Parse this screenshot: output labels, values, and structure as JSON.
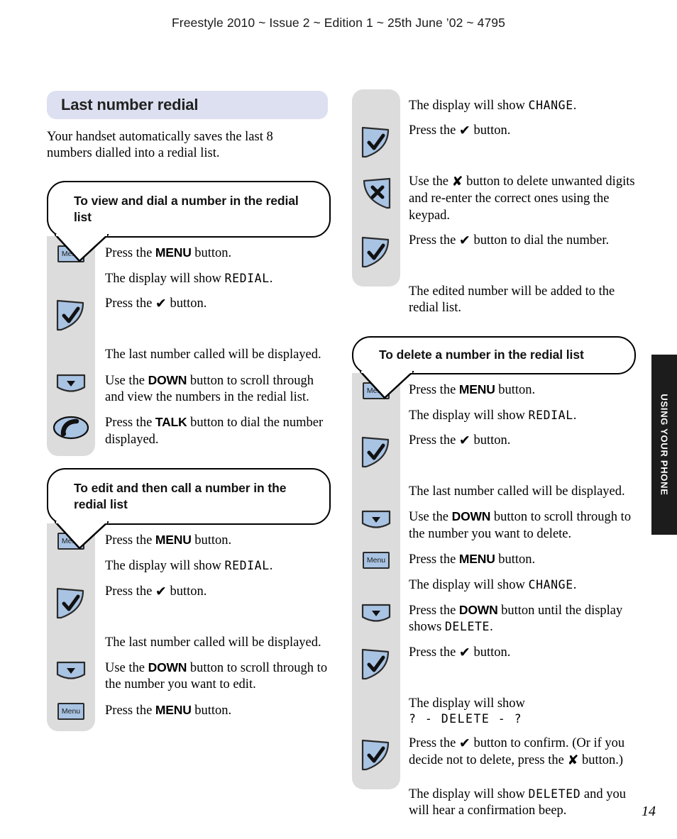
{
  "header": {
    "running_head": "Freestyle 2010 ~ Issue 2 ~ Edition 1 ~ 25th June ’02 ~ 4795"
  },
  "folio": {
    "page_number": "14"
  },
  "thumb_tab": {
    "label": "USING YOUR PHONE"
  },
  "colors": {
    "title_band": "#dde0f0",
    "icon_blue": "#a9c3e3",
    "rail_grey": "#dcdcdc",
    "tab_black": "#1c1c1c",
    "outline": "#2b2b2b"
  },
  "section": {
    "title": "Last number redial",
    "intro": "Your handset automatically saves the last 8 numbers dialled into a redial list."
  },
  "icons": {
    "menu_label": "Menu",
    "check": "check-button-icon",
    "cross": "cross-button-icon",
    "down": "down-button-icon",
    "talk": "talk-button-icon"
  },
  "procedures": [
    {
      "id": "view-and-dial",
      "heading": "To view and dial a number in the redial list",
      "column": "left",
      "steps": [
        {
          "icon": "menu",
          "parts": [
            {
              "t": "Press the "
            },
            {
              "t": "MENU",
              "s": "btn"
            },
            {
              "t": " button."
            }
          ]
        },
        {
          "icon": "none",
          "parts": [
            {
              "t": "The display will show "
            },
            {
              "t": "REDIAL",
              "s": "lcd"
            },
            {
              "t": "."
            }
          ]
        },
        {
          "icon": "check",
          "parts": [
            {
              "t": "Press the "
            },
            {
              "t": "✔",
              "s": "glyph"
            },
            {
              "t": " button."
            }
          ]
        },
        {
          "icon": "none",
          "parts": [
            {
              "t": "The last number called will be displayed."
            }
          ]
        },
        {
          "icon": "down",
          "parts": [
            {
              "t": "Use the "
            },
            {
              "t": "DOWN",
              "s": "btn"
            },
            {
              "t": " button to scroll through and view the numbers in the redial list."
            }
          ]
        },
        {
          "icon": "talk",
          "parts": [
            {
              "t": "Press the "
            },
            {
              "t": "TALK",
              "s": "btn"
            },
            {
              "t": " button to dial the number displayed."
            }
          ]
        }
      ]
    },
    {
      "id": "edit-and-call",
      "heading": "To edit and then call a number in the redial list",
      "column": "left",
      "steps": [
        {
          "icon": "menu",
          "parts": [
            {
              "t": "Press the "
            },
            {
              "t": "MENU",
              "s": "btn"
            },
            {
              "t": " button."
            }
          ]
        },
        {
          "icon": "none",
          "parts": [
            {
              "t": "The display will show "
            },
            {
              "t": "REDIAL",
              "s": "lcd"
            },
            {
              "t": "."
            }
          ]
        },
        {
          "icon": "check",
          "parts": [
            {
              "t": "Press the "
            },
            {
              "t": "✔",
              "s": "glyph"
            },
            {
              "t": " button."
            }
          ]
        },
        {
          "icon": "none",
          "parts": [
            {
              "t": "The last number called will be displayed."
            }
          ]
        },
        {
          "icon": "down",
          "parts": [
            {
              "t": "Use the "
            },
            {
              "t": "DOWN",
              "s": "btn"
            },
            {
              "t": " button to scroll through to the number you want to edit."
            }
          ]
        },
        {
          "icon": "menu",
          "parts": [
            {
              "t": "Press the "
            },
            {
              "t": "MENU",
              "s": "btn"
            },
            {
              "t": " button."
            }
          ]
        }
      ]
    },
    {
      "id": "edit-and-call-continued",
      "heading": null,
      "column": "right",
      "steps": [
        {
          "icon": "none",
          "parts": [
            {
              "t": "The display will show "
            },
            {
              "t": "CHANGE",
              "s": "lcd"
            },
            {
              "t": "."
            }
          ]
        },
        {
          "icon": "check",
          "parts": [
            {
              "t": "Press the "
            },
            {
              "t": "✔",
              "s": "glyph"
            },
            {
              "t": " button."
            }
          ]
        },
        {
          "icon": "cross",
          "parts": [
            {
              "t": "Use the "
            },
            {
              "t": "✘",
              "s": "glyph"
            },
            {
              "t": " button to delete unwanted digits and re-enter the correct ones using the keypad."
            }
          ]
        },
        {
          "icon": "check",
          "parts": [
            {
              "t": "Press the "
            },
            {
              "t": "✔",
              "s": "glyph"
            },
            {
              "t": " button to dial the number."
            }
          ]
        },
        {
          "icon": "none",
          "parts": [
            {
              "t": "The edited number will be added to the redial list."
            }
          ]
        }
      ]
    },
    {
      "id": "delete-a-number",
      "heading": "To delete a number in the redial list",
      "column": "right",
      "steps": [
        {
          "icon": "menu",
          "parts": [
            {
              "t": "Press the "
            },
            {
              "t": "MENU",
              "s": "btn"
            },
            {
              "t": " button."
            }
          ]
        },
        {
          "icon": "none",
          "parts": [
            {
              "t": "The display will show "
            },
            {
              "t": "REDIAL",
              "s": "lcd"
            },
            {
              "t": "."
            }
          ]
        },
        {
          "icon": "check",
          "parts": [
            {
              "t": "Press the "
            },
            {
              "t": "✔",
              "s": "glyph"
            },
            {
              "t": " button."
            }
          ]
        },
        {
          "icon": "none",
          "parts": [
            {
              "t": "The last number called will be displayed."
            }
          ]
        },
        {
          "icon": "down",
          "parts": [
            {
              "t": "Use the "
            },
            {
              "t": "DOWN",
              "s": "btn"
            },
            {
              "t": " button to scroll through to the number you want to delete."
            }
          ]
        },
        {
          "icon": "menu",
          "parts": [
            {
              "t": "Press the "
            },
            {
              "t": "MENU",
              "s": "btn"
            },
            {
              "t": " button."
            }
          ]
        },
        {
          "icon": "none",
          "parts": [
            {
              "t": "The display will show "
            },
            {
              "t": "CHANGE",
              "s": "lcd"
            },
            {
              "t": "."
            }
          ]
        },
        {
          "icon": "down",
          "parts": [
            {
              "t": "Press the "
            },
            {
              "t": "DOWN",
              "s": "btn"
            },
            {
              "t": " button until the display shows "
            },
            {
              "t": "DELETE",
              "s": "lcd"
            },
            {
              "t": "."
            }
          ]
        },
        {
          "icon": "check",
          "parts": [
            {
              "t": "Press the "
            },
            {
              "t": "✔",
              "s": "glyph"
            },
            {
              "t": " button."
            }
          ]
        },
        {
          "icon": "none",
          "parts": [
            {
              "t": "The display will show "
            },
            {
              "t": "? - DELETE - ?",
              "s": "lcd-line"
            }
          ]
        },
        {
          "icon": "check",
          "parts": [
            {
              "t": "Press the "
            },
            {
              "t": "✔",
              "s": "glyph"
            },
            {
              "t": " button to confirm. (Or if you decide not to delete, press the "
            },
            {
              "t": "✘",
              "s": "glyph"
            },
            {
              "t": " button.)"
            }
          ]
        },
        {
          "icon": "none",
          "parts": [
            {
              "t": "The display will show "
            },
            {
              "t": "DELETED",
              "s": "lcd"
            },
            {
              "t": " and you will hear a confirmation beep."
            }
          ]
        }
      ]
    }
  ]
}
